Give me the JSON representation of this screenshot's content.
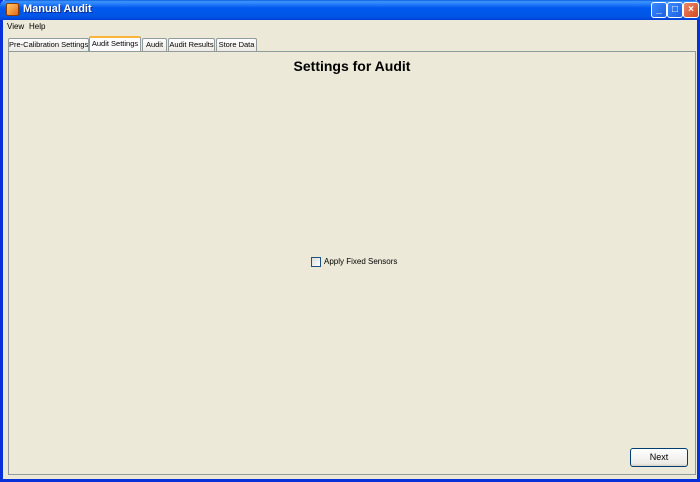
{
  "window": {
    "title": "Manual Audit",
    "controls": {
      "minimize": "minimize-icon",
      "maximize": "maximize-icon",
      "close": "close-icon"
    }
  },
  "menu": {
    "items": [
      "View",
      "Help"
    ]
  },
  "tabs": [
    {
      "label": "Pre-Calibration Settings",
      "active": false
    },
    {
      "label": "Audit Settings",
      "active": true
    },
    {
      "label": "Audit",
      "active": false
    },
    {
      "label": "Audit Results",
      "active": false
    },
    {
      "label": "Store Data",
      "active": false
    }
  ],
  "content": {
    "heading": "Settings for Audit",
    "apply_fixed_sensors": {
      "label": "Apply Fixed Sensors",
      "checked": false
    }
  },
  "footer": {
    "next_label": "Next"
  },
  "colors": {
    "titlebar": "#0055e5",
    "background": "#ece9d8",
    "active_tab_accent": "#f9b43a"
  }
}
